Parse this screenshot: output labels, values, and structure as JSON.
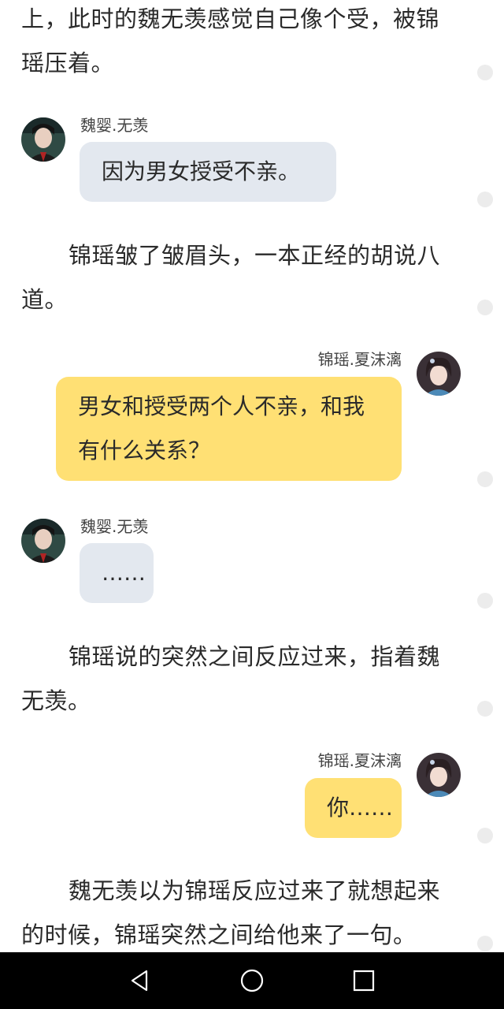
{
  "paragraphs": [
    {
      "text": "上，此时的魏无羡感觉自己像个受，被锦瑶压着。",
      "indent": false
    },
    {
      "text": "锦瑶皱了皱眉头，一本正经的胡说八道。",
      "indent": true
    },
    {
      "text": "锦瑶说的突然之间反应过来，指着魏无羡。",
      "indent": true
    },
    {
      "text": "魏无羡以为锦瑶反应过来了就想起来的时候，锦瑶突然之间给他来了一句。",
      "indent": true
    }
  ],
  "messages": [
    {
      "speaker": "魏婴.无羡",
      "side": "left",
      "text": "因为男女授受不亲。"
    },
    {
      "speaker": "锦瑶.夏沫漓",
      "side": "right",
      "text": "男女和授受两个人不亲，和我有什么关系？"
    },
    {
      "speaker": "魏婴.无羡",
      "side": "left",
      "text": "……"
    },
    {
      "speaker": "锦瑶.夏沫漓",
      "side": "right",
      "text": "你……"
    }
  ],
  "icons": {
    "left_avatar": "male-character-avatar",
    "right_avatar": "female-character-avatar",
    "side_dot": "comment-dot-icon",
    "nav_back": "back-triangle-icon",
    "nav_home": "home-circle-icon",
    "nav_recent": "recent-apps-square-icon"
  },
  "colors": {
    "left_bubble": "#e3e8ef",
    "right_bubble": "#ffe074",
    "nav_bar": "#000000"
  }
}
